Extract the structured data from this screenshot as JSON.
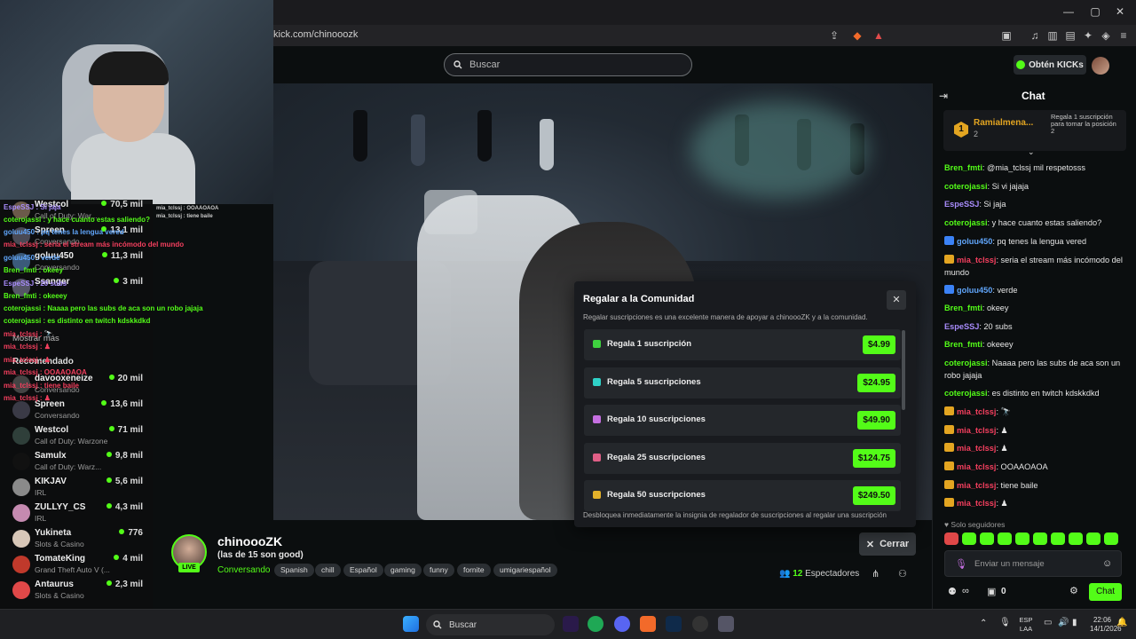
{
  "browser": {
    "url": "kick.com/chinooozk"
  },
  "header": {
    "search_placeholder": "Buscar",
    "kicks_label": "Obtén KICKs"
  },
  "sidebar": {
    "items": [
      {
        "name": "Westcol",
        "category": "Call of Duty: War...",
        "viewers": "70,5 mil"
      },
      {
        "name": "Spreen",
        "category": "Conversando",
        "viewers": "13,1 mil"
      },
      {
        "name": "goluu450",
        "category": "Conversando",
        "viewers": "11,3 mil"
      },
      {
        "name": "Ssanger",
        "category": "",
        "viewers": "3 mil"
      },
      {
        "name": "Mostrar más",
        "category": "",
        "viewers": ""
      },
      {
        "name": "Recomendado",
        "category": "",
        "viewers": ""
      },
      {
        "name": "davooxeneize",
        "category": "Conversando",
        "viewers": "20 mil"
      },
      {
        "name": "Spreen",
        "category": "Conversando",
        "viewers": "13,6 mil"
      },
      {
        "name": "Westcol",
        "category": "Call of Duty: Warzone",
        "viewers": "71 mil"
      },
      {
        "name": "Samulx",
        "category": "Call of Duty: Warz...",
        "viewers": "9,8 mil"
      },
      {
        "name": "KIKJAV",
        "category": "IRL",
        "viewers": "5,6 mil"
      },
      {
        "name": "ZULLYY_CS",
        "category": "IRL",
        "viewers": "4,3 mil"
      },
      {
        "name": "Yukineta",
        "category": "Slots & Casino",
        "viewers": "776"
      },
      {
        "name": "TomateKing",
        "category": "Grand Theft Auto V (...",
        "viewers": "4 mil"
      },
      {
        "name": "Antaurus",
        "category": "Slots & Casino",
        "viewers": "2,3 mil"
      }
    ],
    "overlay_chat": [
      "EspeSSJ : Si jaja",
      "coterojassi : y hace cuanto estas saliendo?",
      "goluu450 : pq tenes la lengua vered",
      "mia_tclssj : seria el stream más incómodo del mundo",
      "goluu450 : verde",
      "Bren_fmti : okeey",
      "EspeSSJ : 20 subs",
      "Bren_fmti : okeeey",
      "coterojassi : Naaaa pero las subs de aca son un robo jajaja",
      "coterojassi : es distinto en twitch kdskkdkd",
      "mia_tclssj : 🔭",
      "mia_tclssj : ♟",
      "mia_tclssj : ♟",
      "mia_tclssj : OOAAOAOA",
      "mia_tclssj : tiene baile",
      "mia_tclssj : ♟"
    ],
    "cam_overlay": [
      "mia_tclssj : OOAAOAOA",
      "mia_tclssj : tiene baile"
    ]
  },
  "stream": {
    "streamer": "chinoooZK",
    "title": "(las de 15 son good)",
    "category": "Conversando",
    "live_label": "LIVE",
    "tags": [
      "Spanish",
      "chill",
      "Español",
      "gaming",
      "funny",
      "fornite",
      "umigariespañol"
    ],
    "viewers_count": "12",
    "viewers_label": "Espectadores",
    "close_label": "Cerrar"
  },
  "modal": {
    "title": "Regalar a la Comunidad",
    "description": "Regalar suscripciones es una excelente manera de apoyar a chinoooZK y a la comunidad.",
    "options": [
      {
        "label": "Regala 1 suscripción",
        "price": "$4.99",
        "color": "#3fd13f"
      },
      {
        "label": "Regala 5 suscripciones",
        "price": "$24.95",
        "color": "#2fd1c7"
      },
      {
        "label": "Regala 10 suscripciones",
        "price": "$49.90",
        "color": "#c56fe0"
      },
      {
        "label": "Regala 25 suscripciones",
        "price": "$124.75",
        "color": "#e05f86"
      },
      {
        "label": "Regala 50 suscripciones",
        "price": "$249.50",
        "color": "#e3b12a"
      }
    ],
    "footer": "Desbloquea inmediatamente la insignia de regalador de suscripciones al regalar una suscripción"
  },
  "chat": {
    "title": "Chat",
    "pinned": {
      "rank": "1",
      "user": "Ramialmena...",
      "count": "2",
      "note": "Regala 1 suscripción para tomar la posición 2"
    },
    "messages": [
      {
        "user": "Bren_fmti",
        "text": ": @mia_tclssj mil respetosss",
        "color": "#53fc18"
      },
      {
        "user": "coterojassi",
        "text": ": Si vi jajaja",
        "color": "#53fc18"
      },
      {
        "user": "EspeSSJ",
        "text": ": Si jaja",
        "color": "#a78bfa"
      },
      {
        "user": "coterojassi",
        "text": ": y hace cuanto estas saliendo?",
        "color": "#53fc18"
      },
      {
        "user": "goluu450",
        "text": ": pq tenes la lengua vered",
        "color": "#60a5fa"
      },
      {
        "user": "mia_tclssj",
        "text": ": seria el stream más incómodo del mundo",
        "color": "#f43f5e"
      },
      {
        "user": "goluu450",
        "text": ": verde",
        "color": "#60a5fa"
      },
      {
        "user": "Bren_fmti",
        "text": ": okeey",
        "color": "#53fc18"
      },
      {
        "user": "EspeSSJ",
        "text": ": 20 subs",
        "color": "#a78bfa"
      },
      {
        "user": "Bren_fmti",
        "text": ": okeeey",
        "color": "#53fc18"
      },
      {
        "user": "coterojassi",
        "text": ": Naaaa pero las subs de aca son un robo jajaja",
        "color": "#53fc18"
      },
      {
        "user": "coterojassi",
        "text": ": es distinto en twitch kdskkdkd",
        "color": "#53fc18"
      },
      {
        "user": "mia_tclssj",
        "text": ": 🔭",
        "color": "#f43f5e"
      },
      {
        "user": "mia_tclssj",
        "text": ": ♟",
        "color": "#f43f5e"
      },
      {
        "user": "mia_tclssj",
        "text": ": ♟",
        "color": "#f43f5e"
      },
      {
        "user": "mia_tclssj",
        "text": ": OOAAOAOA",
        "color": "#f43f5e"
      },
      {
        "user": "mia_tclssj",
        "text": ": tiene baile",
        "color": "#f43f5e"
      },
      {
        "user": "mia_tclssj",
        "text": ": ♟",
        "color": "#f43f5e"
      }
    ],
    "followers_only": "Solo seguidores",
    "input_placeholder": "Enviar un mensaje",
    "points": "0",
    "send_label": "Chat"
  },
  "taskbar": {
    "search_label": "Buscar",
    "lang": "ESP LAA",
    "time": "22:06",
    "date": "14/1/2026"
  }
}
